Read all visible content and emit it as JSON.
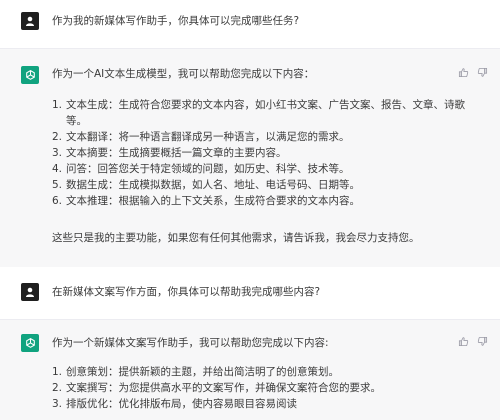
{
  "conversation": {
    "q1": "作为我的新媒体写作助手，你具体可以完成哪些任务?",
    "a1": {
      "intro": "作为一个AI文本生成模型，我可以帮助您完成以下内容：",
      "items": [
        {
          "num": "1.",
          "text": "文本生成：生成符合您要求的文本内容，如小红书文案、广告文案、报告、文章、诗歌",
          "cont": "等。"
        },
        {
          "num": "2.",
          "text": "文本翻译：将一种语言翻译成另一种语言，以满足您的需求。"
        },
        {
          "num": "3.",
          "text": "文本摘要：生成摘要概括一篇文章的主要内容。"
        },
        {
          "num": "4.",
          "text": "问答：回答您关于特定领域的问题，如历史、科学、技术等。"
        },
        {
          "num": "5.",
          "text": "数据生成：生成模拟数据，如人名、地址、电话号码、日期等。"
        },
        {
          "num": "6.",
          "text": "文本推理：根据输入的上下文关系，生成符合要求的文本内容。"
        }
      ],
      "outro": "这些只是我的主要功能，如果您有任何其他需求，请告诉我，我会尽力支持您。"
    },
    "q2": "在新媒体文案写作方面，你具体可以帮助我完成哪些内容?",
    "a2": {
      "intro": "作为一个新媒体文案写作助手，我可以帮助您完成以下内容:",
      "items": [
        {
          "num": "1.",
          "text": "创意策划：提供新颖的主题，并给出简洁明了的创意策划。"
        },
        {
          "num": "2.",
          "text": "文案撰写：为您提供高水平的文案写作，并确保文案符合您的要求。"
        },
        {
          "num": "3.",
          "text": "排版优化：优化排版布局，使内容易眼目容易阅读"
        }
      ]
    }
  },
  "icons": {
    "user_avatar": "user-avatar-icon",
    "bot_avatar": "openai-logo-icon",
    "like": "thumbs-up-icon",
    "dislike": "thumbs-down-icon"
  },
  "colors": {
    "bot_avatar_bg": "#10a37f",
    "user_avatar_bg": "#1f1f1f",
    "bot_row_bg": "#f7f7f8"
  }
}
